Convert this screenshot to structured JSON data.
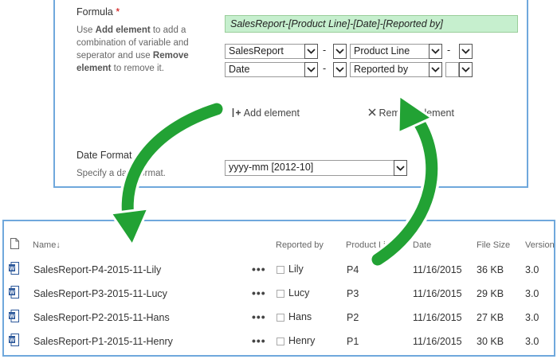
{
  "formula": {
    "label": "Formula",
    "required_mark": "*",
    "help_line1_pre": "Use ",
    "help_line1_bold": "Add element",
    "help_line1_post": " to add a",
    "help_line2": "combination of variable and",
    "help_line3_pre": "seperator and use ",
    "help_line3_bold": "Remove",
    "help_line4_bold": "element",
    "help_line4_post": " to remove it.",
    "value": "SalesReport-[Product Line]-[Date]-[Reported by]",
    "rows": [
      {
        "variable": "SalesReport",
        "separator": "-",
        "field": "Product Line",
        "separator2": "-"
      },
      {
        "variable": "Date",
        "separator": "-",
        "field": "Reported by",
        "separator2": ""
      }
    ],
    "add_label": "Add element",
    "remove_label": "Remove element"
  },
  "date_format": {
    "label": "Date Format",
    "help": "Specify a date format.",
    "value": "yyyy-mm [2012-10]"
  },
  "library": {
    "columns": {
      "name": "Name",
      "sort_arrow": "↓",
      "reported_by": "Reported by",
      "product_line": "Product Line",
      "date": "Date",
      "file_size": "File Size",
      "version": "Version"
    },
    "rows": [
      {
        "name": "SalesReport-P4-2015-11-Lily",
        "reported_by": "Lily",
        "product_line": "P4",
        "date": "11/16/2015",
        "file_size": "36 KB",
        "version": "3.0"
      },
      {
        "name": "SalesReport-P3-2015-11-Lucy",
        "reported_by": "Lucy",
        "product_line": "P3",
        "date": "11/16/2015",
        "file_size": "29 KB",
        "version": "3.0"
      },
      {
        "name": "SalesReport-P2-2015-11-Hans",
        "reported_by": "Hans",
        "product_line": "P2",
        "date": "11/16/2015",
        "file_size": "27 KB",
        "version": "3.0"
      },
      {
        "name": "SalesReport-P1-2015-11-Henry",
        "reported_by": "Henry",
        "product_line": "P1",
        "date": "11/16/2015",
        "file_size": "30 KB",
        "version": "3.0"
      }
    ],
    "more_label": "•••"
  },
  "colors": {
    "panel_border": "#6fa8dc",
    "formula_bg": "#c6efce",
    "arrow_green": "#22a234",
    "word_blue": "#2b579a"
  },
  "icons": {
    "file_type_header": "document-icon",
    "row_file": "word-document-icon",
    "add": "add-element-icon",
    "remove": "x-icon",
    "dropdown": "chevron-down-icon"
  }
}
